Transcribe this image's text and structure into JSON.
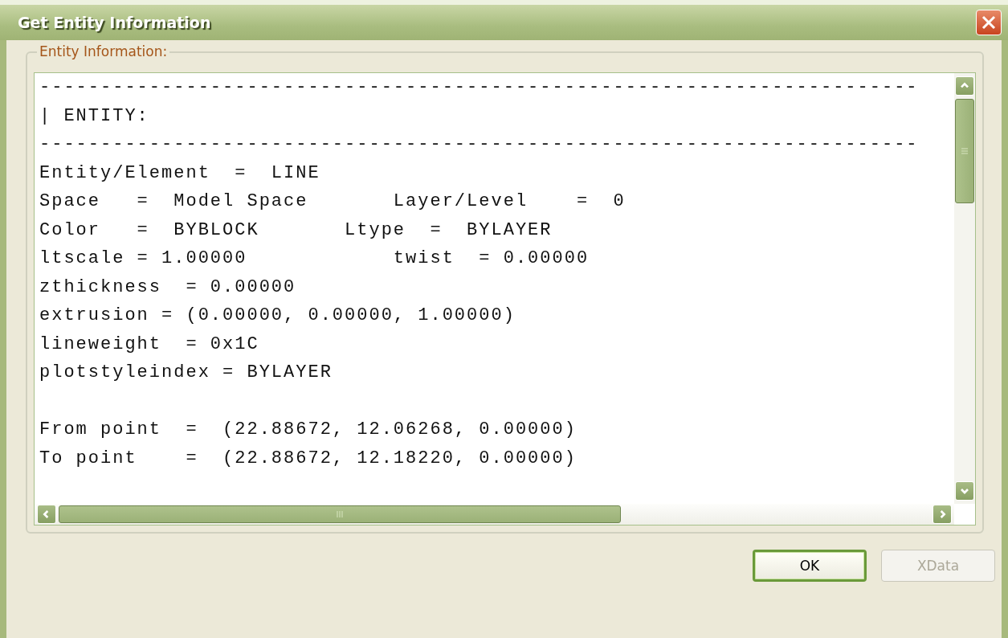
{
  "window": {
    "title": "Get Entity Information"
  },
  "group": {
    "label": "Entity Information:"
  },
  "text_lines": [
    "------------------------------------------------------------------------",
    "| ENTITY:",
    "------------------------------------------------------------------------",
    "Entity/Element  =  LINE",
    "Space   =  Model Space       Layer/Level    =  0",
    "Color   =  BYBLOCK       Ltype  =  BYLAYER",
    "ltscale = 1.00000            twist  = 0.00000",
    "zthickness  = 0.00000",
    "extrusion = (0.00000, 0.00000, 1.00000)",
    "lineweight  = 0x1C",
    "plotstyleindex = BYLAYER"
  ],
  "point_lines": [
    "From point  =  (22.88672, 12.06268, 0.00000)",
    "To point    =  (22.88672, 12.18220, 0.00000)"
  ],
  "buttons": [
    {
      "label": "OK",
      "disabled": false,
      "default": true
    },
    {
      "label": "XData",
      "disabled": true,
      "default": false
    }
  ]
}
